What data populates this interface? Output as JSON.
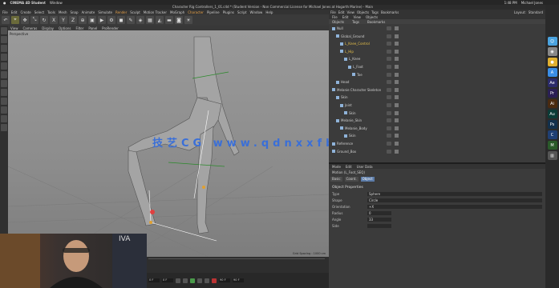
{
  "macbar": {
    "app": "CINEMA 4D Student",
    "menu": "Window",
    "user": "Michael Jones",
    "time": "1:48 PM"
  },
  "titlebar": {
    "text": "Character Rig Controllers_1_01.c4d * (Student Version - Non Commercial License for Michael Jones at Hogarth Marine) - Main"
  },
  "menu": {
    "items": [
      "File",
      "Edit",
      "Create",
      "Select",
      "Tools",
      "Mesh",
      "Snap",
      "Animate",
      "Simulate",
      "Render",
      "Sculpt",
      "Motion Tracker",
      "MoGraph",
      "Character",
      "Pipeline",
      "Plugins",
      "Script",
      "Window",
      "Help"
    ],
    "layout_label": "Layout:",
    "layout_value": "Standard"
  },
  "objmgr_menu": [
    "File",
    "Edit",
    "View",
    "Objects",
    "Tags",
    "Bookmarks"
  ],
  "viewport": {
    "nav": [
      "View",
      "Cameras",
      "Display",
      "Options",
      "Filter",
      "Panel",
      "ProRender"
    ],
    "label": "Perspective",
    "footer": "Grid Spacing : 1000 cm",
    "watermark": "技艺CG  www.qdnxxfb.cn"
  },
  "objects": [
    {
      "name": "Null",
      "indent": 0
    },
    {
      "name": "Global_Ground",
      "indent": 1
    },
    {
      "name": "L_Knee_Control",
      "indent": 2
    },
    {
      "name": "L_Hip",
      "indent": 2
    },
    {
      "name": "L_Knee",
      "indent": 3
    },
    {
      "name": "L_Foot",
      "indent": 4
    },
    {
      "name": "Toe",
      "indent": 5
    },
    {
      "name": "Head",
      "indent": 1
    },
    {
      "name": "Melanie Character Skeleton",
      "indent": 0
    },
    {
      "name": "Skin",
      "indent": 1
    },
    {
      "name": "Joint",
      "indent": 2
    },
    {
      "name": "Skin",
      "indent": 3
    },
    {
      "name": "Melanie_Skin",
      "indent": 1
    },
    {
      "name": "Melanie_Body",
      "indent": 2
    },
    {
      "name": "Skin",
      "indent": 3
    },
    {
      "name": "Reference",
      "indent": 0
    },
    {
      "name": "Ground_Box",
      "indent": 0
    }
  ],
  "attr": {
    "tabs": [
      "Mode",
      "Edit",
      "User Data"
    ],
    "object": "Motion (L_Foot_SEQ)",
    "subtabs": [
      "Basic",
      "Coord.",
      "Object"
    ],
    "section": "Object Properties",
    "rows": [
      {
        "label": "Type",
        "value": "Sphere"
      },
      {
        "label": "Shape",
        "value": "Circle"
      },
      {
        "label": "Orientation",
        "value": "+X"
      },
      {
        "label": "Radius",
        "value": "0"
      },
      {
        "label": "Angle",
        "value": "33"
      },
      {
        "label": "Side",
        "value": ""
      }
    ]
  },
  "anim": {
    "start": "0 F",
    "current": "0 F",
    "end": "90 F",
    "max": "90 F"
  },
  "dock_icons": [
    {
      "name": "finder-icon",
      "color": "#4aa3df",
      "glyph": "☺"
    },
    {
      "name": "launchpad-icon",
      "color": "#888",
      "glyph": "◉"
    },
    {
      "name": "chrome-icon",
      "color": "#e0b030",
      "glyph": "●"
    },
    {
      "name": "app-store-icon",
      "color": "#3a8ee6",
      "glyph": "A"
    },
    {
      "name": "after-effects-icon",
      "color": "#2b2b6a",
      "glyph": "Ae"
    },
    {
      "name": "premiere-icon",
      "color": "#2a1f55",
      "glyph": "Pr"
    },
    {
      "name": "illustrator-icon",
      "color": "#4a2a10",
      "glyph": "Ai"
    },
    {
      "name": "audition-icon",
      "color": "#0b3b36",
      "glyph": "Au"
    },
    {
      "name": "photoshop-icon",
      "color": "#12304c",
      "glyph": "Ps"
    },
    {
      "name": "cinema4d-icon",
      "color": "#1f3f73",
      "glyph": "C"
    },
    {
      "name": "mograph-icon",
      "color": "#2a5a2a",
      "glyph": "M"
    },
    {
      "name": "trash-icon",
      "color": "#555",
      "glyph": "▥"
    }
  ],
  "webcam": {
    "banner": "IVA"
  }
}
